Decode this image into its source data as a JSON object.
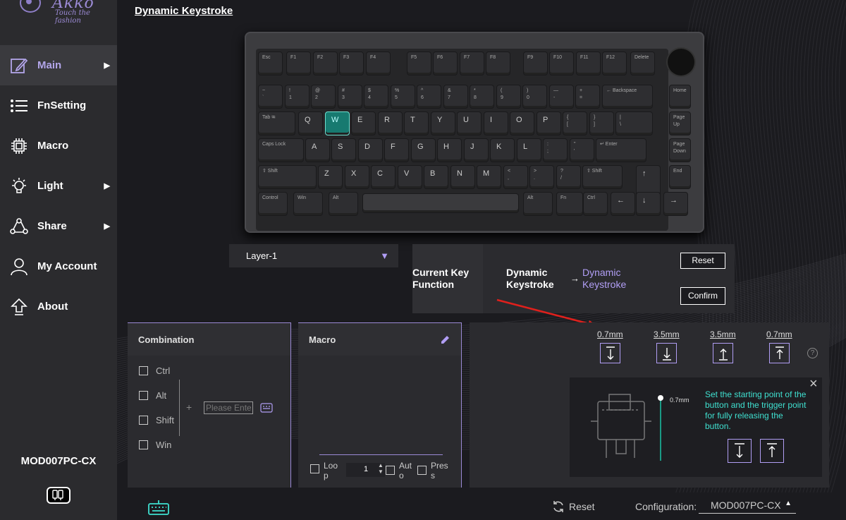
{
  "brand": {
    "name": "Akko",
    "tagline": "Touch the fashion"
  },
  "sidebar": {
    "items": [
      {
        "label": "Main",
        "icon": "edit-icon",
        "has_arrow": true,
        "active": true
      },
      {
        "label": "FnSetting",
        "icon": "list-icon",
        "has_arrow": false
      },
      {
        "label": "Macro",
        "icon": "chip-icon",
        "has_arrow": false
      },
      {
        "label": "Light",
        "icon": "bulb-icon",
        "has_arrow": true
      },
      {
        "label": "Share",
        "icon": "share-icon",
        "has_arrow": true
      },
      {
        "label": "My Account",
        "icon": "user-icon",
        "has_arrow": false
      },
      {
        "label": "About",
        "icon": "upload-icon",
        "has_arrow": false
      }
    ],
    "device": "MOD007PC-CX"
  },
  "page": {
    "title": "Dynamic Keystroke"
  },
  "keyboard": {
    "rows": [
      [
        "Esc",
        "F1",
        "F2",
        "F3",
        "F4",
        "F5",
        "F6",
        "F7",
        "F8",
        "F9",
        "F10",
        "F11",
        "F12",
        "Delete"
      ],
      [
        "~\n`",
        "!\n1",
        "@\n2",
        "#\n3",
        "$\n4",
        "%\n5",
        "^\n6",
        "&\n7",
        "*\n8",
        "(\n9",
        ")\n0",
        "—\n-",
        "+\n=",
        "← Backspace",
        "Home"
      ],
      [
        "Tab ⭾",
        "Q",
        "W",
        "E",
        "R",
        "T",
        "Y",
        "U",
        "I",
        "O",
        "P",
        "{\n[",
        "}\n]",
        "|\n\\",
        "Page\nUp"
      ],
      [
        "Caps Lock",
        "A",
        "S",
        "D",
        "F",
        "G",
        "H",
        "J",
        "K",
        "L",
        ":\n;",
        "\"\n'",
        "↵ Enter",
        "Page\nDown"
      ],
      [
        "⇧ Shift",
        "Z",
        "X",
        "C",
        "V",
        "B",
        "N",
        "M",
        "<\n,",
        ">\n.",
        "?\n/",
        "⇧ Shift",
        "↑",
        "End"
      ],
      [
        "Control",
        "Win",
        "Alt",
        "",
        "Alt",
        "Fn",
        "Ctrl",
        "←",
        "↓",
        "→"
      ]
    ],
    "selected_key": "W"
  },
  "layer": {
    "value": "Layer-1"
  },
  "key_function": {
    "heading": "Current Key Function",
    "current": "Dynamic Keystroke",
    "arrow": "→",
    "target": "Dynamic Keystroke",
    "reset_label": "Reset",
    "confirm_label": "Confirm"
  },
  "combination": {
    "title": "Combination",
    "modifiers": [
      "Ctrl",
      "Alt",
      "Shift",
      "Win"
    ],
    "plus": "+",
    "placeholder": "Please Enter"
  },
  "macro": {
    "title": "Macro",
    "loop_label": "Loop",
    "count": "1",
    "auto_label": "Auto",
    "press_label": "Press"
  },
  "dks": {
    "values": [
      "0.7mm",
      "3.5mm",
      "3.5mm",
      "0.7mm"
    ],
    "slider_value": "0.7mm",
    "help": "?",
    "info_text": "Set the starting point of the button and the trigger point for fully releasing the button.",
    "close": "×"
  },
  "statusbar": {
    "reset_label": "Reset",
    "config_label": "Configuration:",
    "config_value": "MOD007PC-CX"
  },
  "colors": {
    "accent": "#b19ef5",
    "teal": "#3fe0d0",
    "selected_key": "#177a70",
    "arrow": "#e0201c"
  }
}
